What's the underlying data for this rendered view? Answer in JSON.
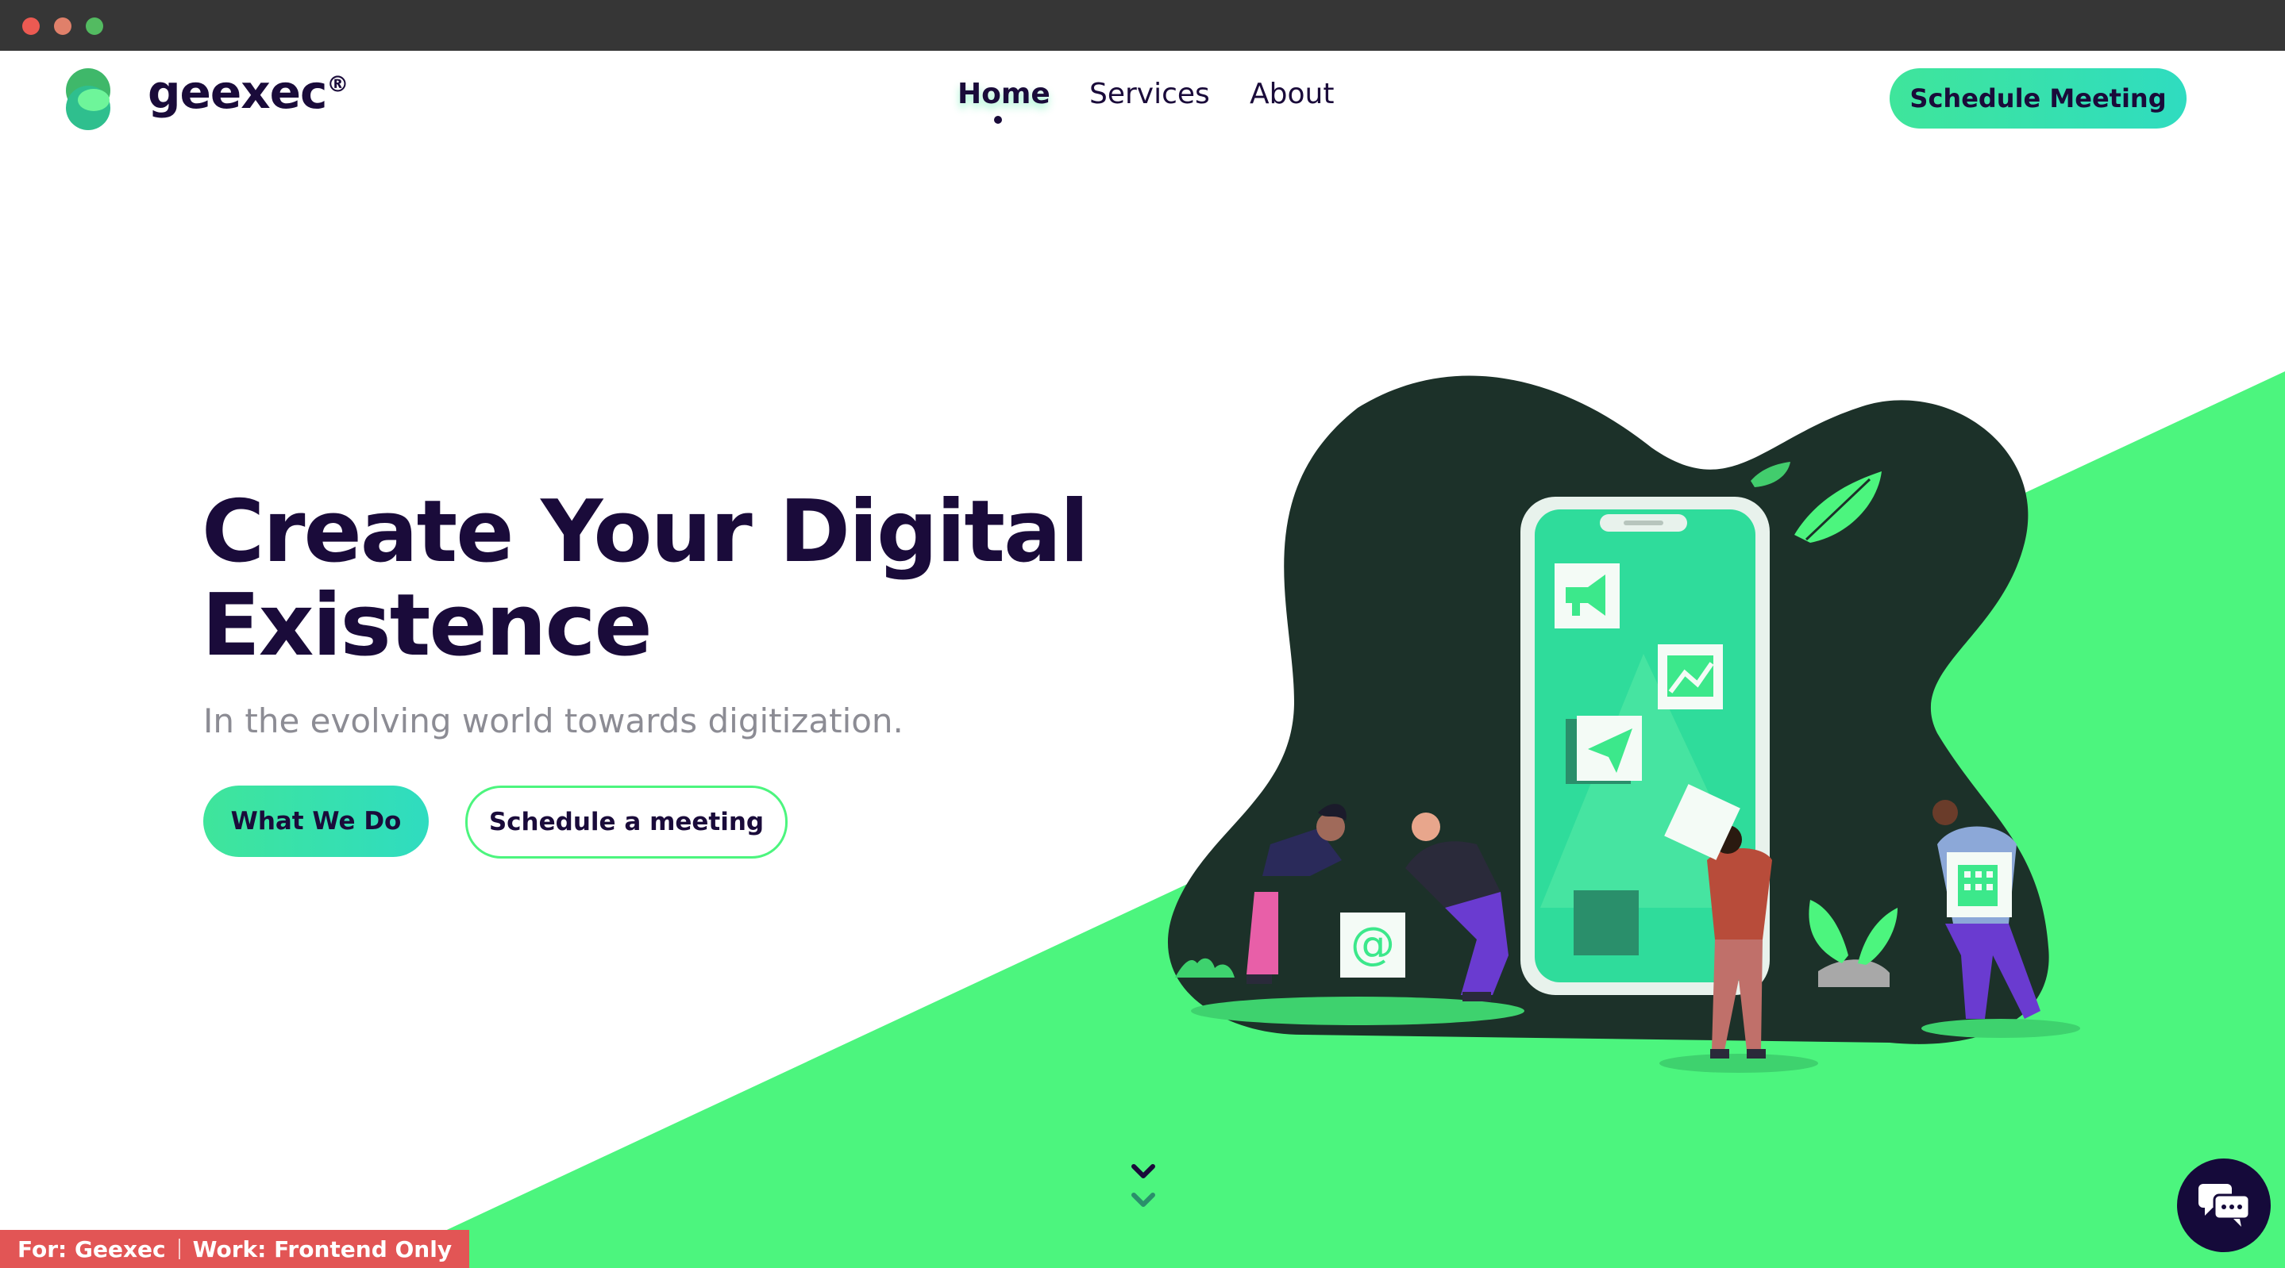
{
  "brand": {
    "name": "geexec",
    "mark": "®"
  },
  "nav": {
    "home": "Home",
    "services": "Services",
    "about": "About"
  },
  "header": {
    "cta": "Schedule Meeting"
  },
  "hero": {
    "title_line1": "Create Your Digital",
    "title_line2": "Existence",
    "subtitle": "In the evolving world towards digitization.",
    "primary_cta": "What We Do",
    "secondary_cta": "Schedule a meeting"
  },
  "tag": {
    "for": "For: Geexec",
    "work": "Work: Frontend Only"
  },
  "icons": {
    "logo": "geexec-logo-icon",
    "scroll": "chevron-down-icon",
    "chat": "chat-bubbles-icon",
    "email": "at-sign-icon",
    "megaphone": "megaphone-icon",
    "chart": "line-chart-icon",
    "send": "paper-plane-icon",
    "building": "building-icon"
  },
  "colors": {
    "navy": "#1a0b3a",
    "green": "#4cf57e",
    "teal": "#2fdcc0",
    "dark_blob": "#1c3129",
    "tag_red": "#e25555"
  }
}
